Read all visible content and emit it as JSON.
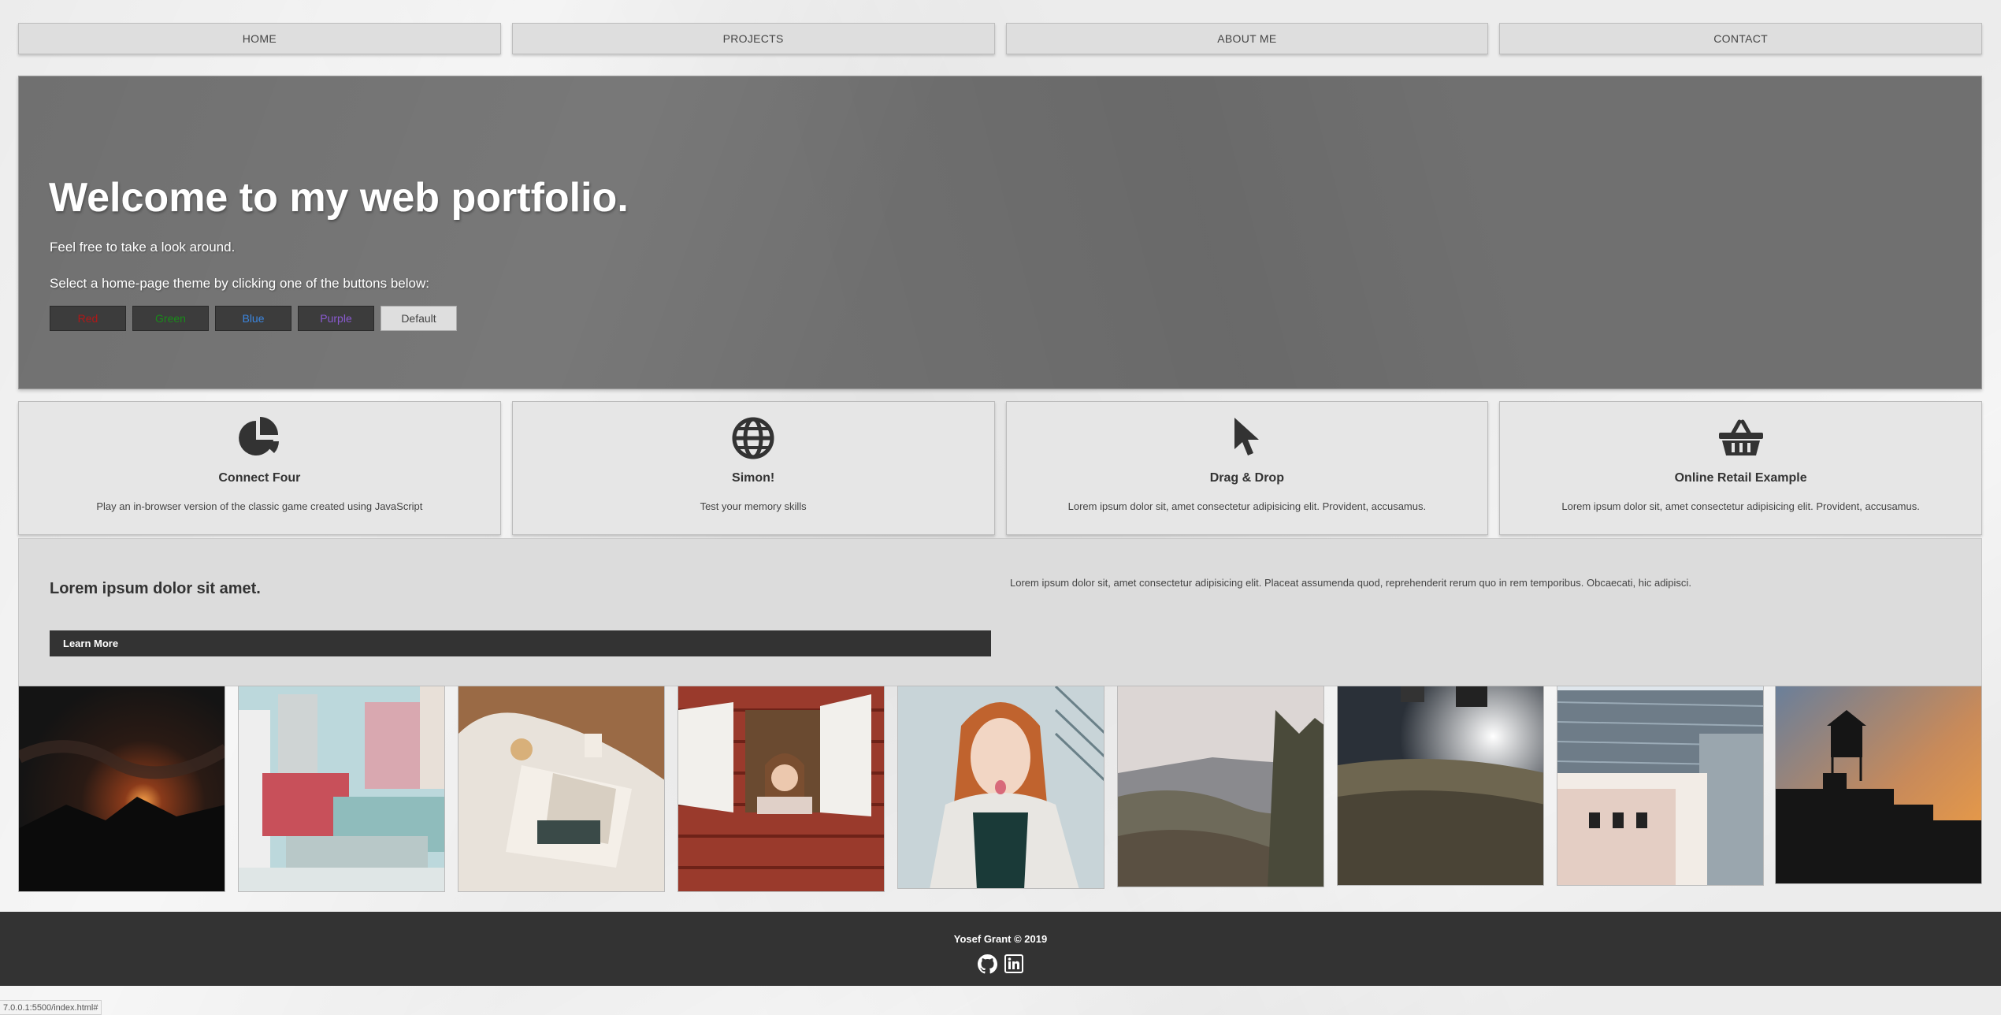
{
  "nav": {
    "items": [
      {
        "label": "HOME"
      },
      {
        "label": "PROJECTS"
      },
      {
        "label": "ABOUT ME"
      },
      {
        "label": "CONTACT"
      }
    ]
  },
  "hero": {
    "title": "Welcome to my web portfolio.",
    "subtitle": "Feel free to take a look around.",
    "select_text": "Select a home-page theme by clicking one of the buttons below:",
    "themes": [
      {
        "label": "Red",
        "color": "#b01818"
      },
      {
        "label": "Green",
        "color": "#1a8a1a"
      },
      {
        "label": "Blue",
        "color": "#3b86e0"
      },
      {
        "label": "Purple",
        "color": "#8a5ad0"
      },
      {
        "label": "Default",
        "color": "#444444"
      }
    ]
  },
  "cards": [
    {
      "icon": "pie-chart-icon",
      "title": "Connect Four",
      "desc": "Play an in-browser version of the classic game created using JavaScript"
    },
    {
      "icon": "globe-icon",
      "title": "Simon!",
      "desc": "Test your memory skills"
    },
    {
      "icon": "mouse-pointer-icon",
      "title": "Drag & Drop",
      "desc": "Lorem ipsum dolor sit, amet consectetur adipisicing elit. Provident, accusamus."
    },
    {
      "icon": "shopping-basket-icon",
      "title": "Online Retail Example",
      "desc": "Lorem ipsum dolor sit, amet consectetur adipisicing elit. Provident, accusamus."
    }
  ],
  "info": {
    "title": "Lorem ipsum dolor sit amet.",
    "button": "Learn More",
    "text": "Lorem ipsum dolor sit, amet consectetur adipisicing elit. Placeat assumenda quod, reprehenderit rerum quo in rem temporibus. Obcaecati, hic adipisci."
  },
  "gallery": [
    {
      "subject": "sunset-mountains-photo"
    },
    {
      "subject": "city-buildings-photo"
    },
    {
      "subject": "book-table-photo"
    },
    {
      "subject": "girl-window-photo"
    },
    {
      "subject": "woman-scarf-photo"
    },
    {
      "subject": "mountain-valley-photo"
    },
    {
      "subject": "ground-closeup-photo"
    },
    {
      "subject": "building-facade-photo"
    },
    {
      "subject": "water-tower-sunset-photo"
    }
  ],
  "footer": {
    "text": "Yosef Grant © 2019",
    "icons": [
      "github-icon",
      "linkedin-icon"
    ]
  },
  "status_url": "7.0.0.1:5500/index.html#"
}
